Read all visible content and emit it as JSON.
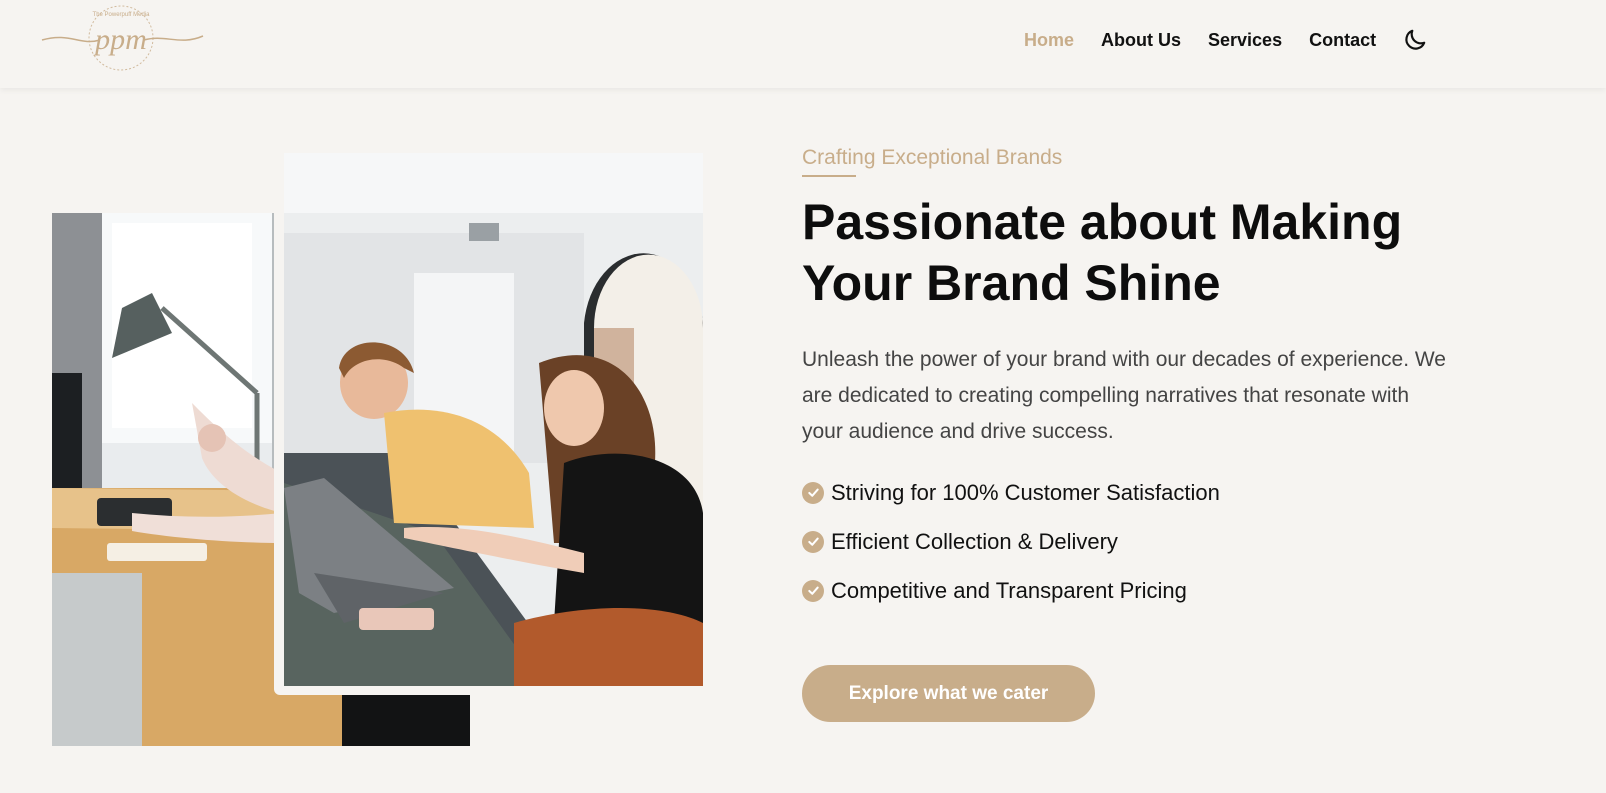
{
  "brand": {
    "logo_text": "ppm",
    "logo_arc_text": "The Powerpuff Media",
    "accent_color": "#c8ad8a"
  },
  "nav": {
    "items": [
      {
        "label": "Home",
        "active": true
      },
      {
        "label": "About Us",
        "active": false
      },
      {
        "label": "Services",
        "active": false
      },
      {
        "label": "Contact",
        "active": false
      }
    ],
    "theme_toggle_icon": "moon-icon"
  },
  "hero": {
    "eyebrow": "Crafting Exceptional Brands",
    "heading_line1": "Passionate about Making",
    "heading_line2": "Your Brand Shine",
    "description": "Unleash the power of your brand with our decades of experience. We are dedicated to creating compelling narratives that resonate with your audience and drive success.",
    "features": [
      {
        "icon": "check-circle-icon",
        "text": "Striving for 100% Customer Satisfaction"
      },
      {
        "icon": "check-circle-icon",
        "text": "Efficient Collection & Delivery"
      },
      {
        "icon": "check-circle-icon",
        "text": "Competitive and Transparent Pricing"
      }
    ],
    "cta_label": "Explore what we cater"
  }
}
